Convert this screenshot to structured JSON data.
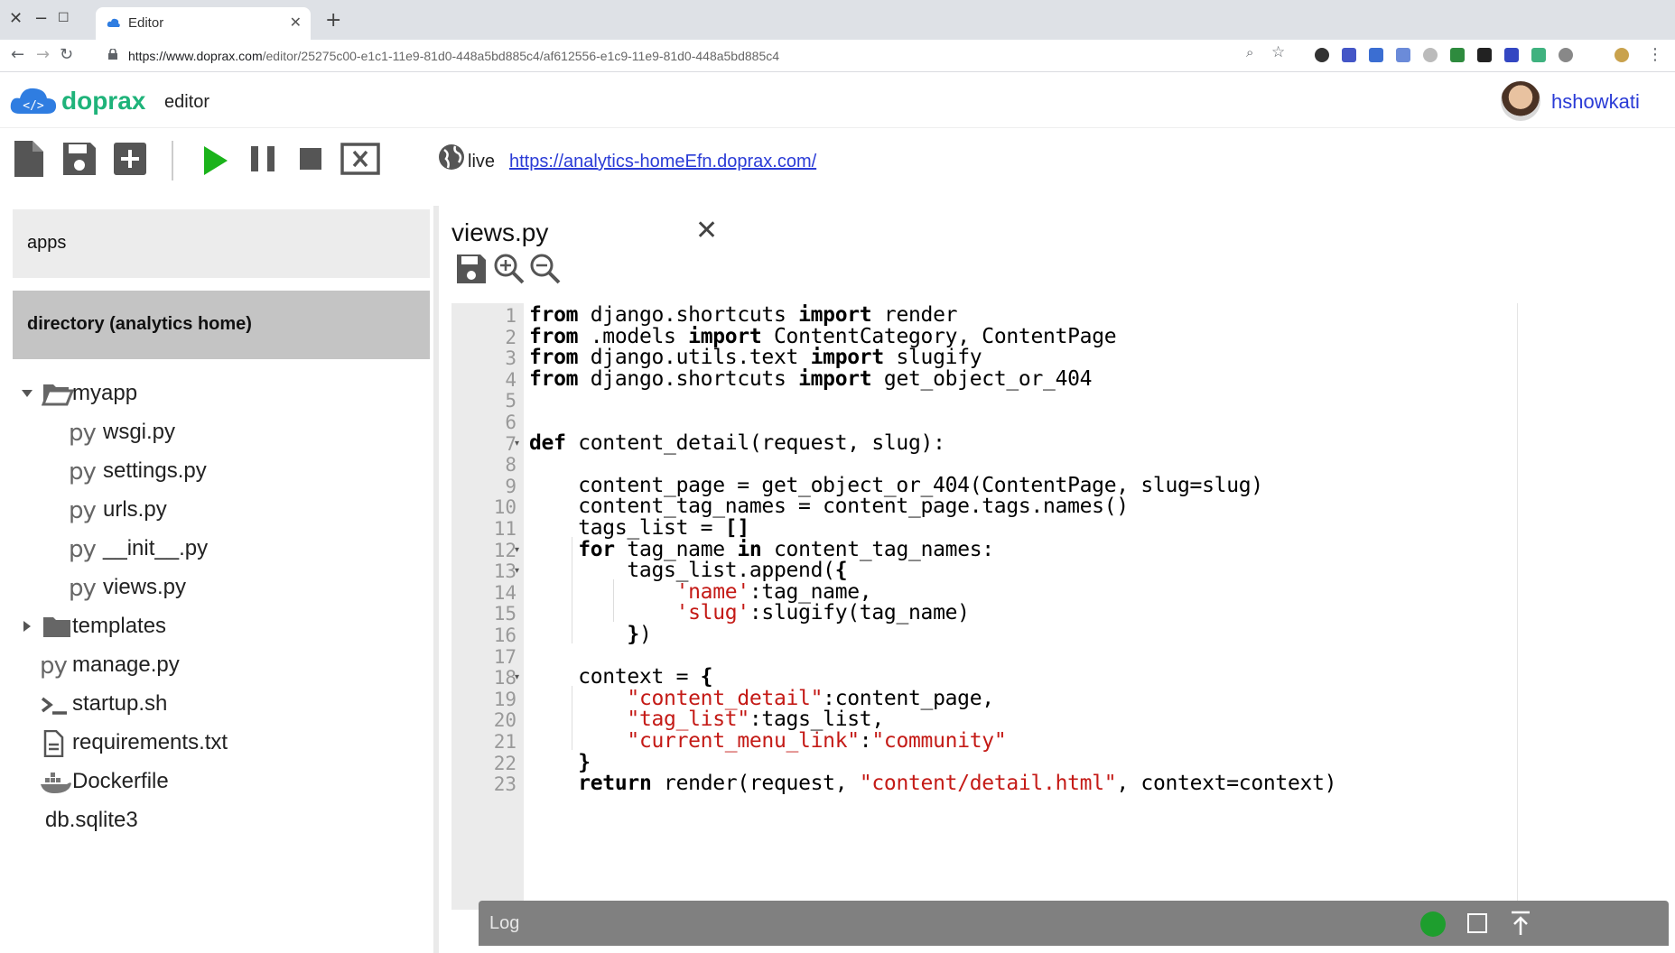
{
  "browser": {
    "tab_title": "Editor",
    "url_domain": "https://www.doprax.com",
    "url_path": "/editor/25275c00-e1c1-11e9-81d0-448a5bd885c4/af612556-e1c9-11e9-81d0-448a5bd885c4"
  },
  "header": {
    "brand": "doprax",
    "brand_suffix": "editor",
    "username": "hshowkati"
  },
  "toolbar": {
    "live_label": "live",
    "live_url": "https://analytics-homeEfn.doprax.com/"
  },
  "sidebar": {
    "apps_label": "apps",
    "directory_label": "directory (analytics home)",
    "tree": [
      {
        "label": "myapp",
        "icon": "folder-open-icon"
      },
      {
        "label": "wsgi.py",
        "icon": "python-file-icon"
      },
      {
        "label": "settings.py",
        "icon": "python-file-icon"
      },
      {
        "label": "urls.py",
        "icon": "python-file-icon"
      },
      {
        "label": "__init__.py",
        "icon": "python-file-icon"
      },
      {
        "label": "views.py",
        "icon": "python-file-icon"
      },
      {
        "label": "templates",
        "icon": "folder-icon"
      },
      {
        "label": "manage.py",
        "icon": "python-file-icon"
      },
      {
        "label": "startup.sh",
        "icon": "terminal-icon"
      },
      {
        "label": "requirements.txt",
        "icon": "text-file-icon"
      },
      {
        "label": "Dockerfile",
        "icon": "docker-icon"
      },
      {
        "label": "db.sqlite3",
        "icon": ""
      }
    ]
  },
  "editor": {
    "filename": "views.py",
    "line_numbers": [
      "1",
      "2",
      "3",
      "4",
      "5",
      "6",
      "7",
      "8",
      "9",
      "10",
      "11",
      "12",
      "13",
      "14",
      "15",
      "16",
      "17",
      "18",
      "19",
      "20",
      "21",
      "22",
      "23"
    ],
    "lines": [
      [
        {
          "t": "from",
          "k": "kw"
        },
        {
          "t": " django.shortcuts "
        },
        {
          "t": "import",
          "k": "kw"
        },
        {
          "t": " render"
        }
      ],
      [
        {
          "t": "from",
          "k": "kw"
        },
        {
          "t": " .models "
        },
        {
          "t": "import",
          "k": "kw"
        },
        {
          "t": " ContentCategory, ContentPage"
        }
      ],
      [
        {
          "t": "from",
          "k": "kw"
        },
        {
          "t": " django.utils.text "
        },
        {
          "t": "import",
          "k": "kw"
        },
        {
          "t": " slugify"
        }
      ],
      [
        {
          "t": "from",
          "k": "kw"
        },
        {
          "t": " django.shortcuts "
        },
        {
          "t": "import",
          "k": "kw"
        },
        {
          "t": " get_object_or_404"
        }
      ],
      [],
      [],
      [
        {
          "t": "def",
          "k": "kw"
        },
        {
          "t": " content_detail(request, slug):"
        }
      ],
      [],
      [
        {
          "t": "    content_page = get_object_or_404(ContentPage, slug=slug)"
        }
      ],
      [
        {
          "t": "    content_tag_names = content_page.tags.names()"
        }
      ],
      [
        {
          "t": "    tags_list = "
        },
        {
          "t": "[]",
          "k": "kw"
        }
      ],
      [
        {
          "t": "    "
        },
        {
          "t": "for",
          "k": "kw"
        },
        {
          "t": " tag_name "
        },
        {
          "t": "in",
          "k": "kw"
        },
        {
          "t": " content_tag_names:"
        }
      ],
      [
        {
          "t": "        tags_list.append("
        },
        {
          "t": "{",
          "k": "kw"
        }
      ],
      [
        {
          "t": "            "
        },
        {
          "t": "'name'",
          "k": "str"
        },
        {
          "t": ":tag_name,"
        }
      ],
      [
        {
          "t": "            "
        },
        {
          "t": "'slug'",
          "k": "str"
        },
        {
          "t": ":slugify(tag_name)"
        }
      ],
      [
        {
          "t": "        "
        },
        {
          "t": "}",
          "k": "kw"
        },
        {
          "t": ")"
        }
      ],
      [],
      [
        {
          "t": "    context = "
        },
        {
          "t": "{",
          "k": "kw"
        }
      ],
      [
        {
          "t": "        "
        },
        {
          "t": "\"content_detail\"",
          "k": "str"
        },
        {
          "t": ":content_page,"
        }
      ],
      [
        {
          "t": "        "
        },
        {
          "t": "\"tag_list\"",
          "k": "str"
        },
        {
          "t": ":tags_list,"
        }
      ],
      [
        {
          "t": "        "
        },
        {
          "t": "\"current_menu_link\"",
          "k": "str"
        },
        {
          "t": ":"
        },
        {
          "t": "\"community\"",
          "k": "str"
        }
      ],
      [
        {
          "t": "    "
        },
        {
          "t": "}",
          "k": "kw"
        }
      ],
      [
        {
          "t": "    "
        },
        {
          "t": "return",
          "k": "kw"
        },
        {
          "t": " render(request, "
        },
        {
          "t": "\"content/detail.html\"",
          "k": "str"
        },
        {
          "t": ", context=context)"
        }
      ]
    ],
    "fold_lines": [
      "7",
      "12",
      "13",
      "18"
    ]
  },
  "log": {
    "label": "Log",
    "status_color": "#1e9e2e"
  },
  "colors": {
    "brand": "#1fb37a",
    "link": "#2a3bd6",
    "logo_blue": "#2f7de1",
    "play_green": "#1bb31b",
    "string_red": "#c41a16"
  }
}
